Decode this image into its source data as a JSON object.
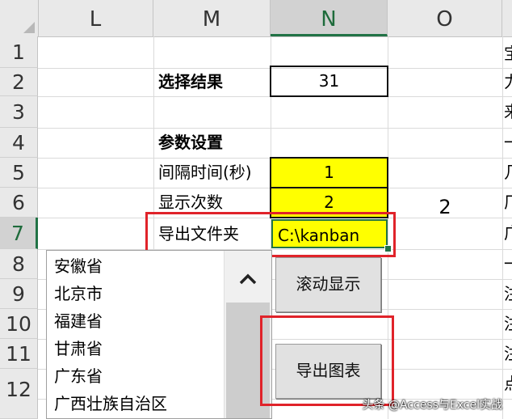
{
  "columns": [
    "L",
    "M",
    "N",
    "O"
  ],
  "rows": [
    "1",
    "2",
    "3",
    "4",
    "5",
    "6",
    "7",
    "8",
    "9",
    "10",
    "11",
    "12"
  ],
  "selected_column": "N",
  "selected_row": "7",
  "cells": {
    "select_result_label": "选择结果",
    "select_result_value": "31",
    "params_label": "参数设置",
    "interval_label": "间隔时间(秒)",
    "interval_value": "1",
    "count_label": "显示次数",
    "count_value": "2",
    "o6_value": "2",
    "export_folder_label": "导出文件夹",
    "export_folder_value": "C:\\kanban"
  },
  "listbox": {
    "items": [
      "安徽省",
      "北京市",
      "福建省",
      "甘肃省",
      "广东省",
      "广西壮族自治区"
    ]
  },
  "buttons": {
    "scroll_display": "滚动显示",
    "export_chart": "导出图表"
  },
  "right_edge_chars": [
    "宝",
    "力",
    "来",
    "一",
    "几",
    "厂",
    "广",
    "一",
    "注",
    "注",
    "注",
    "点"
  ],
  "watermark": "头条 @Access与Excel实战",
  "colors": {
    "highlight": "#ffff00",
    "annotation_red": "#e0232a",
    "excel_green": "#217346"
  }
}
